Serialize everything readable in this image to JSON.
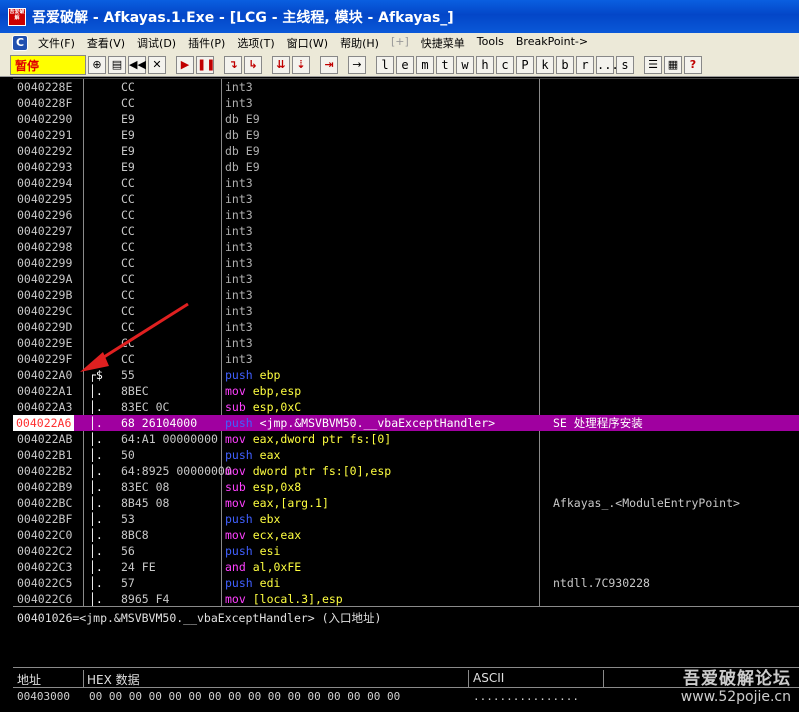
{
  "window": {
    "title": "吾爱破解 - Afkayas.1.Exe - [LCG - 主线程, 模块 - Afkayas_]",
    "logo_text": "吾爱破解"
  },
  "menu": {
    "items": [
      {
        "label": "文件(F)",
        "dim": false
      },
      {
        "label": "查看(V)",
        "dim": false
      },
      {
        "label": "调试(D)",
        "dim": false
      },
      {
        "label": "插件(P)",
        "dim": false
      },
      {
        "label": "选项(T)",
        "dim": false
      },
      {
        "label": "窗口(W)",
        "dim": false
      },
      {
        "label": "帮助(H)",
        "dim": false
      },
      {
        "label": "[+]",
        "dim": true
      },
      {
        "label": "快捷菜单",
        "dim": false
      },
      {
        "label": "Tools",
        "dim": false
      },
      {
        "label": "BreakPoint->",
        "dim": false
      }
    ]
  },
  "toolbar": {
    "status": "暂停",
    "letters": [
      "l",
      "e",
      "m",
      "t",
      "w",
      "h",
      "c",
      "P",
      "k",
      "b",
      "r",
      "...",
      "s"
    ]
  },
  "cpu": {
    "rows": [
      {
        "addr": "0040228E",
        "mark": "",
        "hex": "CC",
        "mnem": "int3",
        "ops": "",
        "kind": "plain",
        "comment": ""
      },
      {
        "addr": "0040228F",
        "mark": "",
        "hex": "CC",
        "mnem": "int3",
        "ops": "",
        "kind": "plain",
        "comment": ""
      },
      {
        "addr": "00402290",
        "mark": "",
        "hex": "E9",
        "mnem": "db E9",
        "ops": "",
        "kind": "plain",
        "comment": ""
      },
      {
        "addr": "00402291",
        "mark": "",
        "hex": "E9",
        "mnem": "db E9",
        "ops": "",
        "kind": "plain",
        "comment": ""
      },
      {
        "addr": "00402292",
        "mark": "",
        "hex": "E9",
        "mnem": "db E9",
        "ops": "",
        "kind": "plain",
        "comment": ""
      },
      {
        "addr": "00402293",
        "mark": "",
        "hex": "E9",
        "mnem": "db E9",
        "ops": "",
        "kind": "plain",
        "comment": ""
      },
      {
        "addr": "00402294",
        "mark": "",
        "hex": "CC",
        "mnem": "int3",
        "ops": "",
        "kind": "plain",
        "comment": ""
      },
      {
        "addr": "00402295",
        "mark": "",
        "hex": "CC",
        "mnem": "int3",
        "ops": "",
        "kind": "plain",
        "comment": ""
      },
      {
        "addr": "00402296",
        "mark": "",
        "hex": "CC",
        "mnem": "int3",
        "ops": "",
        "kind": "plain",
        "comment": ""
      },
      {
        "addr": "00402297",
        "mark": "",
        "hex": "CC",
        "mnem": "int3",
        "ops": "",
        "kind": "plain",
        "comment": ""
      },
      {
        "addr": "00402298",
        "mark": "",
        "hex": "CC",
        "mnem": "int3",
        "ops": "",
        "kind": "plain",
        "comment": ""
      },
      {
        "addr": "00402299",
        "mark": "",
        "hex": "CC",
        "mnem": "int3",
        "ops": "",
        "kind": "plain",
        "comment": ""
      },
      {
        "addr": "0040229A",
        "mark": "",
        "hex": "CC",
        "mnem": "int3",
        "ops": "",
        "kind": "plain",
        "comment": ""
      },
      {
        "addr": "0040229B",
        "mark": "",
        "hex": "CC",
        "mnem": "int3",
        "ops": "",
        "kind": "plain",
        "comment": ""
      },
      {
        "addr": "0040229C",
        "mark": "",
        "hex": "CC",
        "mnem": "int3",
        "ops": "",
        "kind": "plain",
        "comment": ""
      },
      {
        "addr": "0040229D",
        "mark": "",
        "hex": "CC",
        "mnem": "int3",
        "ops": "",
        "kind": "plain",
        "comment": ""
      },
      {
        "addr": "0040229E",
        "mark": "",
        "hex": "CC",
        "mnem": "int3",
        "ops": "",
        "kind": "plain",
        "comment": ""
      },
      {
        "addr": "0040229F",
        "mark": "",
        "hex": "CC",
        "mnem": "int3",
        "ops": "",
        "kind": "plain",
        "comment": ""
      },
      {
        "addr": "004022A0",
        "mark": "┌$",
        "hex": "55",
        "mnem": "push",
        "ops": "ebp",
        "kind": "stack",
        "comment": ""
      },
      {
        "addr": "004022A1",
        "mark": "│.",
        "hex": "8BEC",
        "mnem": "mov",
        "ops": "ebp,esp",
        "kind": "mov",
        "comment": ""
      },
      {
        "addr": "004022A3",
        "mark": "│.",
        "hex": "83EC 0C",
        "mnem": "sub",
        "ops": "esp,0xC",
        "kind": "mov",
        "comment": ""
      },
      {
        "addr": "004022A6",
        "mark": "│.",
        "hex": "68 26104000",
        "mnem": "push",
        "ops": "<jmp.&MSVBVM50.__vbaExceptHandler>",
        "kind": "stack",
        "comment": "SE 处理程序安装",
        "hl": true
      },
      {
        "addr": "004022AB",
        "mark": "│.",
        "hex": "64:A1 00000000",
        "mnem": "mov",
        "ops": "eax,dword ptr fs:[0]",
        "kind": "mov",
        "comment": ""
      },
      {
        "addr": "004022B1",
        "mark": "│.",
        "hex": "50",
        "mnem": "push",
        "ops": "eax",
        "kind": "stack",
        "comment": ""
      },
      {
        "addr": "004022B2",
        "mark": "│.",
        "hex": "64:8925 00000000",
        "mnem": "mov",
        "ops": "dword ptr fs:[0],esp",
        "kind": "mov",
        "comment": ""
      },
      {
        "addr": "004022B9",
        "mark": "│.",
        "hex": "83EC 08",
        "mnem": "sub",
        "ops": "esp,0x8",
        "kind": "mov",
        "comment": ""
      },
      {
        "addr": "004022BC",
        "mark": "│.",
        "hex": "8B45 08",
        "mnem": "mov",
        "ops": "eax,[arg.1]",
        "kind": "mov",
        "comment": "Afkayas_.<ModuleEntryPoint>"
      },
      {
        "addr": "004022BF",
        "mark": "│.",
        "hex": "53",
        "mnem": "push",
        "ops": "ebx",
        "kind": "stack",
        "comment": ""
      },
      {
        "addr": "004022C0",
        "mark": "│.",
        "hex": "8BC8",
        "mnem": "mov",
        "ops": "ecx,eax",
        "kind": "mov",
        "comment": ""
      },
      {
        "addr": "004022C2",
        "mark": "│.",
        "hex": "56",
        "mnem": "push",
        "ops": "esi",
        "kind": "stack",
        "comment": ""
      },
      {
        "addr": "004022C3",
        "mark": "│.",
        "hex": "24 FE",
        "mnem": "and",
        "ops": "al,0xFE",
        "kind": "mov",
        "comment": ""
      },
      {
        "addr": "004022C5",
        "mark": "│.",
        "hex": "57",
        "mnem": "push",
        "ops": "edi",
        "kind": "stack",
        "comment": "ntdll.7C930228"
      },
      {
        "addr": "004022C6",
        "mark": "│.",
        "hex": "8965 F4",
        "mnem": "mov",
        "ops": "[local.3],esp",
        "kind": "mov",
        "comment": ""
      }
    ]
  },
  "info": {
    "text": "00401026=<jmp.&MSVBVM50.__vbaExceptHandler> (入口地址)"
  },
  "dump": {
    "headers": {
      "address": "地址",
      "hex": "HEX 数据",
      "ascii": "ASCII"
    },
    "row": {
      "addr": "00403000",
      "hex": "00 00 00 00  00 00 00 00  00 00 00 00  00 00 00 00",
      "ascii": "................"
    }
  },
  "watermark": {
    "line1": "吾爱破解论坛",
    "line2": "www.52pojie.cn"
  },
  "colors": {
    "highlight_row": "#a000a0",
    "stack_mnemonic": "#4060ff",
    "mov_mnemonic": "#ff40ff",
    "operand": "#ffff40",
    "annotation_arrow": "#e02020"
  }
}
